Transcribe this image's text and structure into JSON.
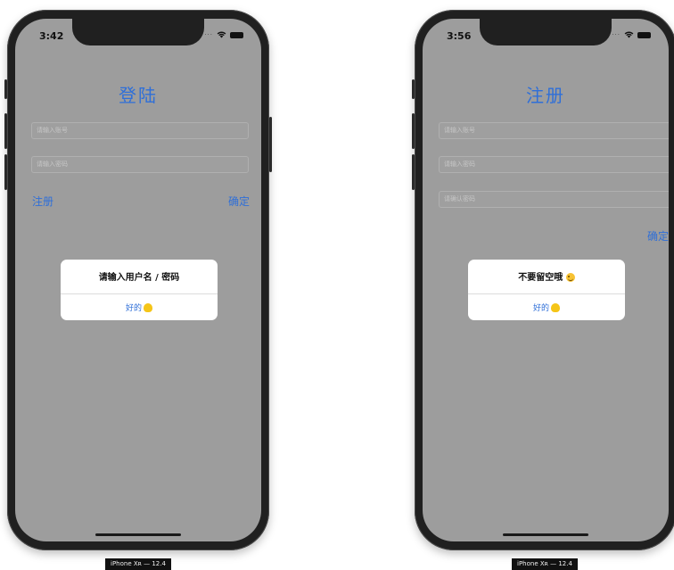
{
  "login": {
    "status_time": "3:42",
    "title": "登陆",
    "account_placeholder": "请输入账号",
    "password_placeholder": "请输入密码",
    "register_label": "注册",
    "confirm_label": "确定",
    "alert": {
      "message": "请输入用户名 / 密码",
      "ok_label": "好的"
    },
    "device_label": "iPhone Xʀ — 12.4"
  },
  "register": {
    "status_time": "3:56",
    "title": "注册",
    "account_placeholder": "请输入账号",
    "password_placeholder": "请输入密码",
    "confirm_password_placeholder": "请确认密码",
    "confirm_label": "确定",
    "alert": {
      "message": "不要留空哦",
      "ok_label": "好的"
    },
    "device_label": "iPhone Xʀ — 12.4"
  },
  "icons": {
    "ok_hand": "ok-hand-icon",
    "wink": "wink-icon",
    "wifi": "wifi-icon",
    "battery": "battery-icon",
    "cellular": "cellular-icon"
  },
  "colors": {
    "accent": "#2f6fd8",
    "screen_overlay": "#9d9d9d",
    "bezel": "#202020",
    "alert_bg": "#ffffff"
  }
}
